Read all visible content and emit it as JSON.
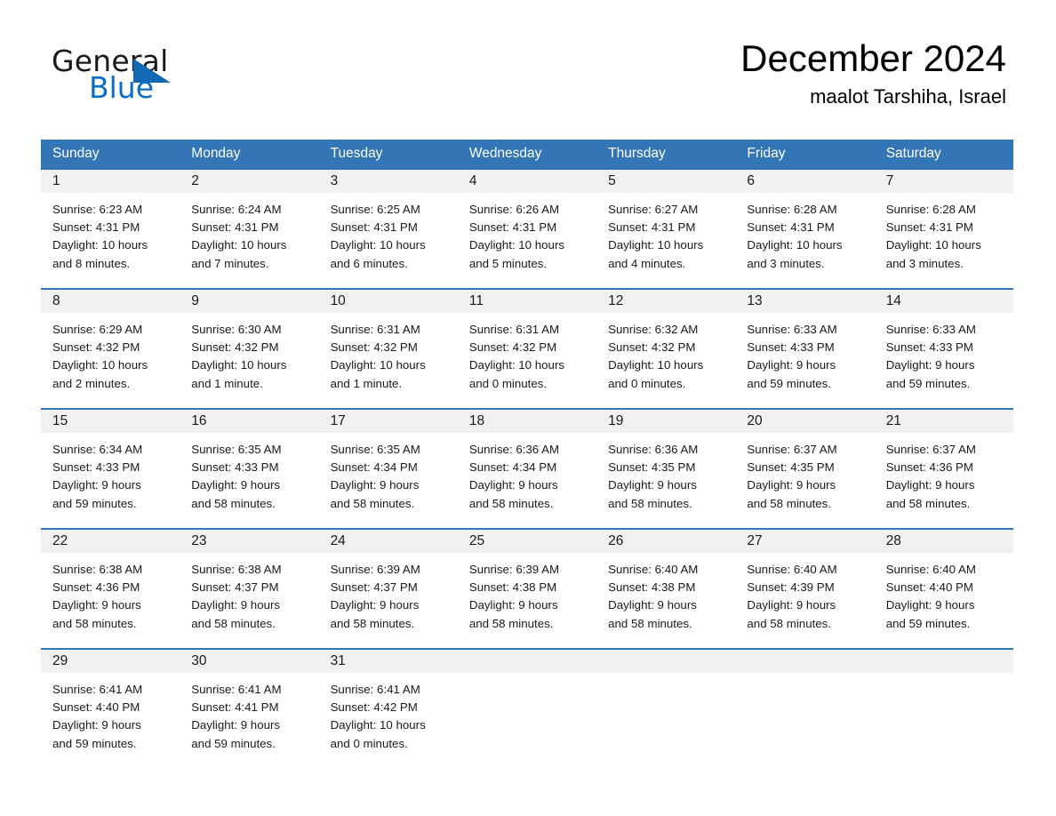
{
  "brand": {
    "name_part1": "General",
    "name_part2": "Blue",
    "triangle_color": "#1268b3",
    "blue_color": "#0b6ec4"
  },
  "header": {
    "title": "December 2024",
    "location": "maalot Tarshiha, Israel"
  },
  "theme": {
    "header_blue": "#3375b5",
    "daynum_strip": "#f1f1f1",
    "row_divider": "#3375b5"
  },
  "weekdays": [
    "Sunday",
    "Monday",
    "Tuesday",
    "Wednesday",
    "Thursday",
    "Friday",
    "Saturday"
  ],
  "weeks": [
    [
      {
        "date": "1",
        "sunrise": "Sunrise: 6:23 AM",
        "sunset": "Sunset: 4:31 PM",
        "daylight_line1": "Daylight: 10 hours",
        "daylight_line2": "and 8 minutes."
      },
      {
        "date": "2",
        "sunrise": "Sunrise: 6:24 AM",
        "sunset": "Sunset: 4:31 PM",
        "daylight_line1": "Daylight: 10 hours",
        "daylight_line2": "and 7 minutes."
      },
      {
        "date": "3",
        "sunrise": "Sunrise: 6:25 AM",
        "sunset": "Sunset: 4:31 PM",
        "daylight_line1": "Daylight: 10 hours",
        "daylight_line2": "and 6 minutes."
      },
      {
        "date": "4",
        "sunrise": "Sunrise: 6:26 AM",
        "sunset": "Sunset: 4:31 PM",
        "daylight_line1": "Daylight: 10 hours",
        "daylight_line2": "and 5 minutes."
      },
      {
        "date": "5",
        "sunrise": "Sunrise: 6:27 AM",
        "sunset": "Sunset: 4:31 PM",
        "daylight_line1": "Daylight: 10 hours",
        "daylight_line2": "and 4 minutes."
      },
      {
        "date": "6",
        "sunrise": "Sunrise: 6:28 AM",
        "sunset": "Sunset: 4:31 PM",
        "daylight_line1": "Daylight: 10 hours",
        "daylight_line2": "and 3 minutes."
      },
      {
        "date": "7",
        "sunrise": "Sunrise: 6:28 AM",
        "sunset": "Sunset: 4:31 PM",
        "daylight_line1": "Daylight: 10 hours",
        "daylight_line2": "and 3 minutes."
      }
    ],
    [
      {
        "date": "8",
        "sunrise": "Sunrise: 6:29 AM",
        "sunset": "Sunset: 4:32 PM",
        "daylight_line1": "Daylight: 10 hours",
        "daylight_line2": "and 2 minutes."
      },
      {
        "date": "9",
        "sunrise": "Sunrise: 6:30 AM",
        "sunset": "Sunset: 4:32 PM",
        "daylight_line1": "Daylight: 10 hours",
        "daylight_line2": "and 1 minute."
      },
      {
        "date": "10",
        "sunrise": "Sunrise: 6:31 AM",
        "sunset": "Sunset: 4:32 PM",
        "daylight_line1": "Daylight: 10 hours",
        "daylight_line2": "and 1 minute."
      },
      {
        "date": "11",
        "sunrise": "Sunrise: 6:31 AM",
        "sunset": "Sunset: 4:32 PM",
        "daylight_line1": "Daylight: 10 hours",
        "daylight_line2": "and 0 minutes."
      },
      {
        "date": "12",
        "sunrise": "Sunrise: 6:32 AM",
        "sunset": "Sunset: 4:32 PM",
        "daylight_line1": "Daylight: 10 hours",
        "daylight_line2": "and 0 minutes."
      },
      {
        "date": "13",
        "sunrise": "Sunrise: 6:33 AM",
        "sunset": "Sunset: 4:33 PM",
        "daylight_line1": "Daylight: 9 hours",
        "daylight_line2": "and 59 minutes."
      },
      {
        "date": "14",
        "sunrise": "Sunrise: 6:33 AM",
        "sunset": "Sunset: 4:33 PM",
        "daylight_line1": "Daylight: 9 hours",
        "daylight_line2": "and 59 minutes."
      }
    ],
    [
      {
        "date": "15",
        "sunrise": "Sunrise: 6:34 AM",
        "sunset": "Sunset: 4:33 PM",
        "daylight_line1": "Daylight: 9 hours",
        "daylight_line2": "and 59 minutes."
      },
      {
        "date": "16",
        "sunrise": "Sunrise: 6:35 AM",
        "sunset": "Sunset: 4:33 PM",
        "daylight_line1": "Daylight: 9 hours",
        "daylight_line2": "and 58 minutes."
      },
      {
        "date": "17",
        "sunrise": "Sunrise: 6:35 AM",
        "sunset": "Sunset: 4:34 PM",
        "daylight_line1": "Daylight: 9 hours",
        "daylight_line2": "and 58 minutes."
      },
      {
        "date": "18",
        "sunrise": "Sunrise: 6:36 AM",
        "sunset": "Sunset: 4:34 PM",
        "daylight_line1": "Daylight: 9 hours",
        "daylight_line2": "and 58 minutes."
      },
      {
        "date": "19",
        "sunrise": "Sunrise: 6:36 AM",
        "sunset": "Sunset: 4:35 PM",
        "daylight_line1": "Daylight: 9 hours",
        "daylight_line2": "and 58 minutes."
      },
      {
        "date": "20",
        "sunrise": "Sunrise: 6:37 AM",
        "sunset": "Sunset: 4:35 PM",
        "daylight_line1": "Daylight: 9 hours",
        "daylight_line2": "and 58 minutes."
      },
      {
        "date": "21",
        "sunrise": "Sunrise: 6:37 AM",
        "sunset": "Sunset: 4:36 PM",
        "daylight_line1": "Daylight: 9 hours",
        "daylight_line2": "and 58 minutes."
      }
    ],
    [
      {
        "date": "22",
        "sunrise": "Sunrise: 6:38 AM",
        "sunset": "Sunset: 4:36 PM",
        "daylight_line1": "Daylight: 9 hours",
        "daylight_line2": "and 58 minutes."
      },
      {
        "date": "23",
        "sunrise": "Sunrise: 6:38 AM",
        "sunset": "Sunset: 4:37 PM",
        "daylight_line1": "Daylight: 9 hours",
        "daylight_line2": "and 58 minutes."
      },
      {
        "date": "24",
        "sunrise": "Sunrise: 6:39 AM",
        "sunset": "Sunset: 4:37 PM",
        "daylight_line1": "Daylight: 9 hours",
        "daylight_line2": "and 58 minutes."
      },
      {
        "date": "25",
        "sunrise": "Sunrise: 6:39 AM",
        "sunset": "Sunset: 4:38 PM",
        "daylight_line1": "Daylight: 9 hours",
        "daylight_line2": "and 58 minutes."
      },
      {
        "date": "26",
        "sunrise": "Sunrise: 6:40 AM",
        "sunset": "Sunset: 4:38 PM",
        "daylight_line1": "Daylight: 9 hours",
        "daylight_line2": "and 58 minutes."
      },
      {
        "date": "27",
        "sunrise": "Sunrise: 6:40 AM",
        "sunset": "Sunset: 4:39 PM",
        "daylight_line1": "Daylight: 9 hours",
        "daylight_line2": "and 58 minutes."
      },
      {
        "date": "28",
        "sunrise": "Sunrise: 6:40 AM",
        "sunset": "Sunset: 4:40 PM",
        "daylight_line1": "Daylight: 9 hours",
        "daylight_line2": "and 59 minutes."
      }
    ],
    [
      {
        "date": "29",
        "sunrise": "Sunrise: 6:41 AM",
        "sunset": "Sunset: 4:40 PM",
        "daylight_line1": "Daylight: 9 hours",
        "daylight_line2": "and 59 minutes."
      },
      {
        "date": "30",
        "sunrise": "Sunrise: 6:41 AM",
        "sunset": "Sunset: 4:41 PM",
        "daylight_line1": "Daylight: 9 hours",
        "daylight_line2": "and 59 minutes."
      },
      {
        "date": "31",
        "sunrise": "Sunrise: 6:41 AM",
        "sunset": "Sunset: 4:42 PM",
        "daylight_line1": "Daylight: 10 hours",
        "daylight_line2": "and 0 minutes."
      },
      {
        "date": "",
        "sunrise": "",
        "sunset": "",
        "daylight_line1": "",
        "daylight_line2": ""
      },
      {
        "date": "",
        "sunrise": "",
        "sunset": "",
        "daylight_line1": "",
        "daylight_line2": ""
      },
      {
        "date": "",
        "sunrise": "",
        "sunset": "",
        "daylight_line1": "",
        "daylight_line2": ""
      },
      {
        "date": "",
        "sunrise": "",
        "sunset": "",
        "daylight_line1": "",
        "daylight_line2": ""
      }
    ]
  ]
}
